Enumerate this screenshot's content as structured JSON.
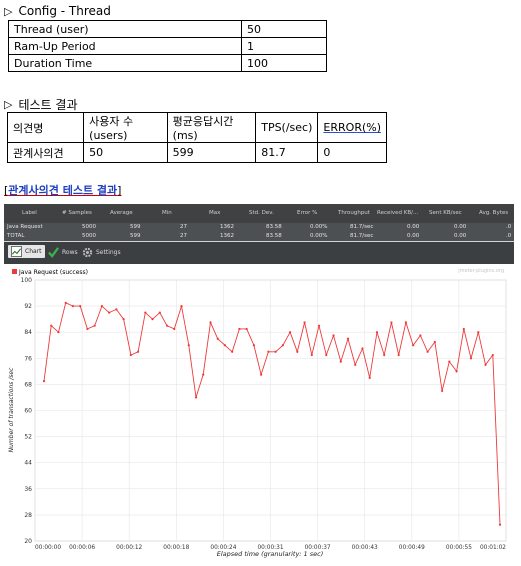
{
  "section1": {
    "marker": "▷",
    "title": "Config - Thread"
  },
  "config_table": [
    {
      "label": "Thread (user)",
      "value": "50"
    },
    {
      "label": "Ram-Up Period",
      "value": "1"
    },
    {
      "label": "Duration Time",
      "value": "100"
    }
  ],
  "section2": {
    "marker": "▷",
    "title": "테스트 결과"
  },
  "result_table": {
    "headers": [
      "의견명",
      "사용자 수(users)",
      "평균응답시간(ms)",
      "TPS(/sec)",
      "ERROR(%)"
    ],
    "row": [
      "관계사의견",
      "50",
      "599",
      "81.7",
      "0"
    ]
  },
  "link_text": "관계사의견 테스트 결과",
  "jmeter": {
    "headers": [
      "Label",
      "# Samples",
      "Average",
      "Min",
      "Max",
      "Std. Dev.",
      "Error %",
      "Throughput",
      "Received KB/...",
      "Sent KB/sec",
      "Avg. Bytes"
    ],
    "rows": [
      [
        "Java Request",
        "5000",
        "599",
        "27",
        "1362",
        "83.58",
        "0.00%",
        "81.7/sec",
        "0.00",
        "0.00",
        ".0"
      ],
      [
        "TOTAL",
        "5000",
        "599",
        "27",
        "1362",
        "83.58",
        "0.00%",
        "81.7/sec",
        "0.00",
        "0.00",
        ".0"
      ]
    ],
    "tabs": [
      {
        "label": "Chart",
        "icon": "chart-icon"
      },
      {
        "label": "Rows",
        "icon": "check-icon"
      },
      {
        "label": "Settings",
        "icon": "gear-icon"
      }
    ],
    "watermark": "jmeter-plugins.org"
  },
  "colors": {
    "series": "#ee3a3a",
    "grid": "#e6e6e6",
    "header_bg": "#3f4143"
  },
  "chart_data": {
    "type": "line",
    "title": "",
    "legend": "Java Request (success)",
    "xlabel": "Elapsed time (granularity: 1 sec)",
    "ylabel": "Number of transactions /sec",
    "ylim": [
      20,
      100
    ],
    "yticks": [
      20,
      28,
      36,
      44,
      52,
      60,
      68,
      76,
      84,
      92,
      100
    ],
    "xticks": [
      "00:00:00",
      "00:00:06",
      "00:00:12",
      "00:00:18",
      "00:00:24",
      "00:00:31",
      "00:00:37",
      "00:00:43",
      "00:00:49",
      "00:00:55",
      "00:01:02"
    ],
    "x_seconds": [
      1,
      2,
      3,
      4,
      5,
      6,
      7,
      8,
      9,
      10,
      11,
      12,
      13,
      14,
      15,
      16,
      17,
      18,
      19,
      20,
      21,
      22,
      23,
      24,
      25,
      26,
      27,
      28,
      29,
      30,
      31,
      32,
      33,
      34,
      35,
      36,
      37,
      38,
      39,
      40,
      41,
      42,
      43,
      44,
      45,
      46,
      47,
      48,
      49,
      50,
      51,
      52,
      53,
      54,
      55,
      56,
      57,
      58,
      59,
      60,
      61
    ],
    "values": [
      69,
      86,
      84,
      93,
      92,
      92,
      85,
      86,
      92,
      90,
      91,
      88,
      77,
      78,
      90,
      88,
      90,
      86,
      85,
      92,
      80,
      64,
      71,
      87,
      82,
      80,
      78,
      85,
      85,
      80,
      71,
      78,
      78,
      80,
      84,
      78,
      87,
      77,
      86,
      77,
      83,
      75,
      82,
      74,
      79,
      70,
      84,
      77,
      87,
      77,
      87,
      80,
      83,
      78,
      81,
      66,
      75,
      72,
      85,
      76,
      84,
      74,
      77,
      25
    ]
  }
}
